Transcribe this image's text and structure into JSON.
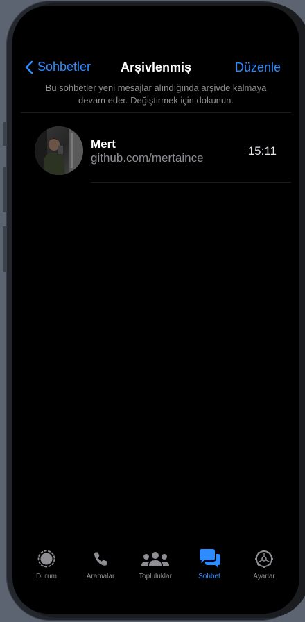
{
  "nav": {
    "back_label": "Sohbetler",
    "title": "Arşivlenmiş",
    "edit_label": "Düzenle"
  },
  "info": {
    "line1": "Bu sohbetler yeni mesajlar alındığında arşivde kalmaya",
    "line2": "devam eder. Değiştirmek için dokunun."
  },
  "chats": [
    {
      "name": "Mert",
      "preview": "github.com/mertaince",
      "time": "15:11"
    }
  ],
  "tabs": [
    {
      "label": "Durum",
      "icon": "status-icon",
      "active": false
    },
    {
      "label": "Aramalar",
      "icon": "phone-icon",
      "active": false
    },
    {
      "label": "Topluluklar",
      "icon": "communities-icon",
      "active": false
    },
    {
      "label": "Sohbet",
      "icon": "chats-icon",
      "active": true
    },
    {
      "label": "Ayarlar",
      "icon": "settings-icon",
      "active": false
    }
  ],
  "colors": {
    "accent": "#2f8cff",
    "background": "#000000",
    "secondary_text": "#8e8e93"
  }
}
